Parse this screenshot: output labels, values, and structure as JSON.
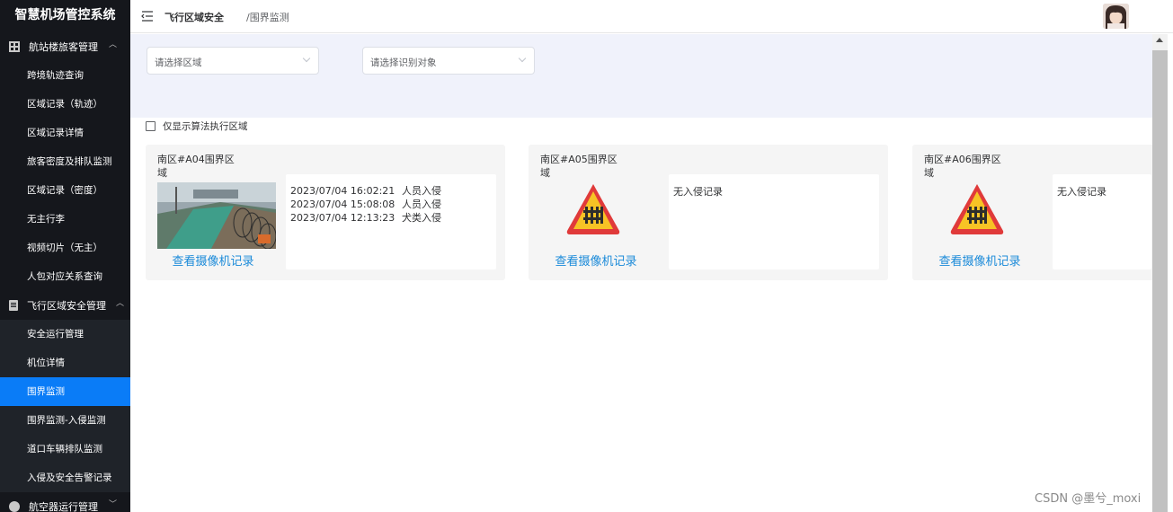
{
  "app": {
    "title": "智慧机场管控系统"
  },
  "sidebar": {
    "groups": [
      {
        "label": "航站楼旅客管理",
        "icon": "grid-icon",
        "items": [
          "跨境轨迹查询",
          "区域记录（轨迹）",
          "区域记录详情",
          "旅客密度及排队监测",
          "区域记录（密度）",
          "无主行李",
          "视频切片（无主）",
          "人包对应关系查询"
        ]
      },
      {
        "label": "飞行区域安全管理",
        "icon": "document-icon",
        "items": [
          "安全运行管理",
          "机位详情",
          "围界监测",
          "围界监测-入侵监测",
          "道口车辆排队监测",
          "入侵及安全告警记录"
        ],
        "active": "围界监测"
      },
      {
        "label": "航空器运行管理",
        "icon": "plane-icon"
      }
    ]
  },
  "header": {
    "breadcrumb": [
      "飞行区域安全",
      "/围界监测"
    ]
  },
  "filters": {
    "region_placeholder": "请选择区域",
    "target_placeholder": "请选择识别对象",
    "checkbox_label": "仅显示算法执行区域"
  },
  "cards": [
    {
      "title": "南区#A04围界区域",
      "link": "查看摄像机记录",
      "records": [
        {
          "time": "2023/07/04 16:02:21",
          "type": "人员入侵"
        },
        {
          "time": "2023/07/04 15:08:08",
          "type": "人员入侵"
        },
        {
          "time": "2023/07/04 12:13:23",
          "type": "犬类入侵"
        }
      ]
    },
    {
      "title": "南区#A05围界区域",
      "link": "查看摄像机记录",
      "empty": "无入侵记录"
    },
    {
      "title": "南区#A06围界区域",
      "link": "查看摄像机记录",
      "empty": "无入侵记录"
    }
  ],
  "watermark": "CSDN @墨兮_moxi",
  "colors": {
    "sidebar_bg": "#15171c",
    "active": "#0a7cf7",
    "link": "#1a8ad9",
    "filter_bg": "#f0f2fb"
  }
}
